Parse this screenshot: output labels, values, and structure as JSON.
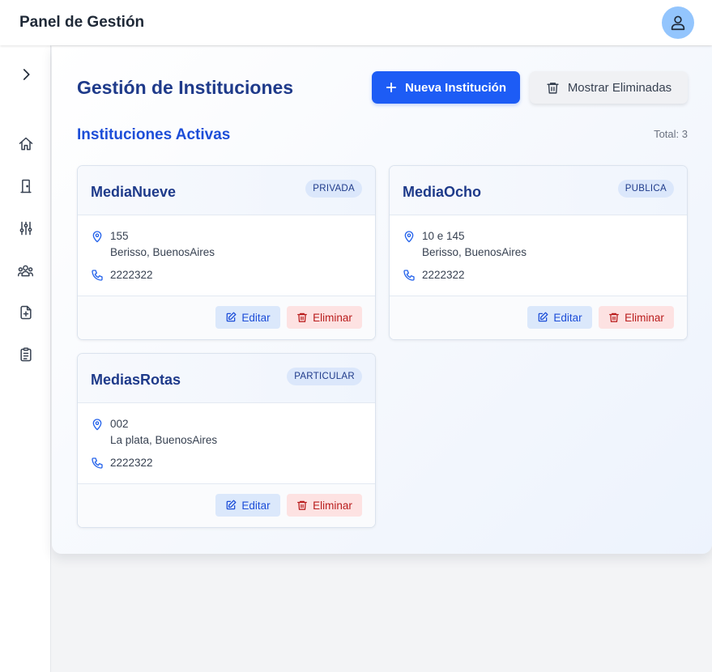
{
  "app": {
    "title": "Panel de Gestión"
  },
  "header": {
    "avatar_icon": "user-icon"
  },
  "sidebar": {
    "items": [
      {
        "icon": "chevron-right-icon"
      },
      {
        "icon": "home-icon"
      },
      {
        "icon": "door-icon"
      },
      {
        "icon": "sliders-icon"
      },
      {
        "icon": "users-icon"
      },
      {
        "icon": "file-plus-icon"
      },
      {
        "icon": "clipboard-list-icon"
      }
    ]
  },
  "main": {
    "title": "Gestión de Instituciones",
    "new_button": "Nueva Institución",
    "show_deleted_button": "Mostrar Eliminadas",
    "section_title": "Instituciones Activas",
    "total_label": "Total: 3",
    "edit_label": "Editar",
    "delete_label": "Eliminar",
    "institutions": [
      {
        "name": "MediaNueve",
        "type": "PRIVADA",
        "address": "155",
        "city": "Berisso, BuenosAires",
        "phone": "2222322"
      },
      {
        "name": "MediaOcho",
        "type": "PUBLICA",
        "address": "10 e 145",
        "city": "Berisso, BuenosAires",
        "phone": "2222322"
      },
      {
        "name": "MediasRotas",
        "type": "PARTICULAR",
        "address": "002",
        "city": "La plata, BuenosAires",
        "phone": "2222322"
      }
    ]
  },
  "colors": {
    "primary": "#1d5cf5",
    "title": "#1e3a8a",
    "danger_bg": "#fde2e2",
    "danger_text": "#b91c1c"
  }
}
